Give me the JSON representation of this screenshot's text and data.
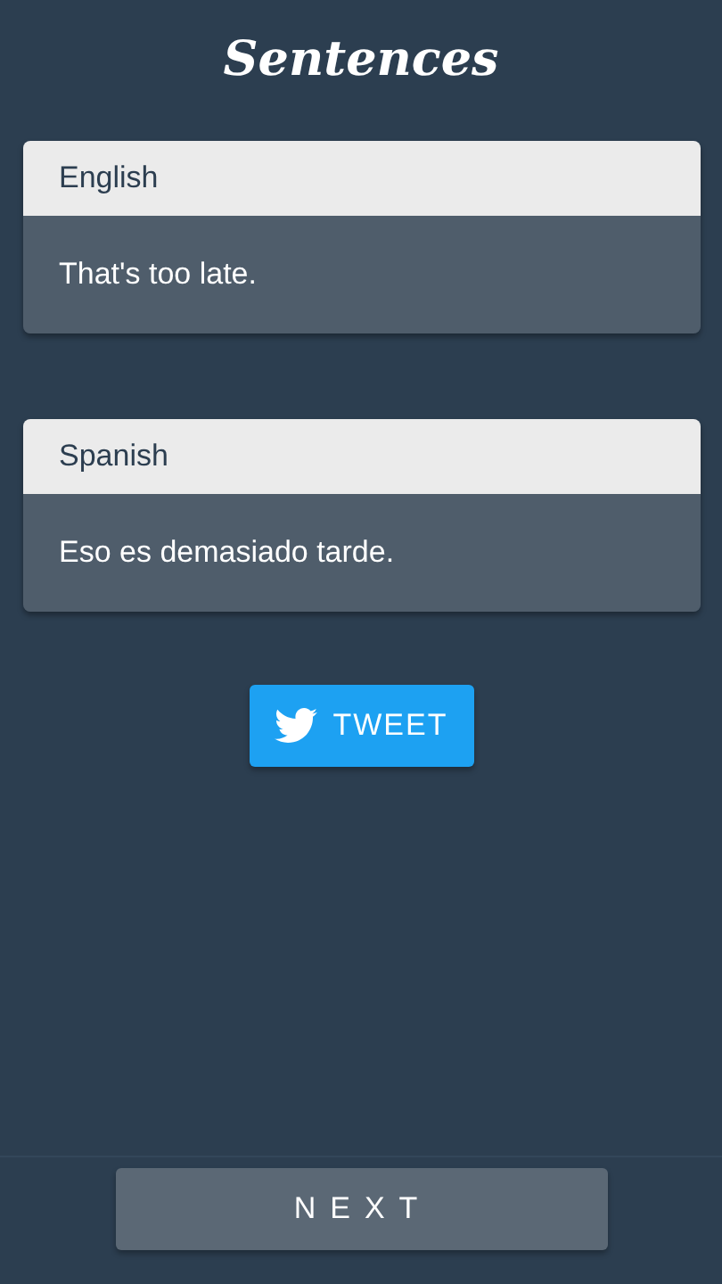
{
  "title": "Sentences",
  "cards": [
    {
      "language": "English",
      "sentence": "That's too late."
    },
    {
      "language": "Spanish",
      "sentence": "Eso es demasiado tarde."
    }
  ],
  "tweet_button": {
    "label": "TWEET"
  },
  "next_button": {
    "label": "NEXT"
  }
}
